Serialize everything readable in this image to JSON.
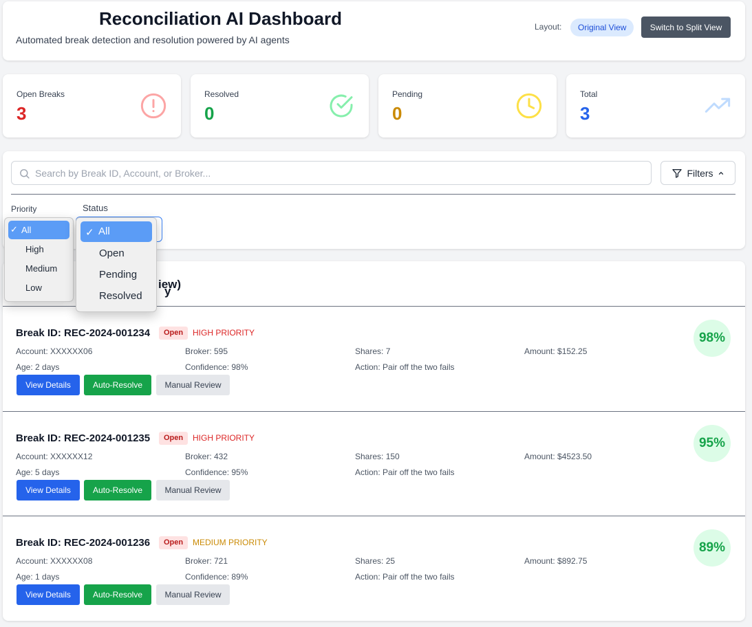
{
  "header": {
    "title": "Reconciliation AI Dashboard",
    "subtitle": "Automated break detection and resolution powered by AI agents",
    "layout_label": "Layout:",
    "layout_value": "Original View",
    "switch_button": "Switch to Split View"
  },
  "stats": [
    {
      "label": "Open Breaks",
      "value": "3",
      "color": "#dc2626",
      "icon": "alert-circle-icon"
    },
    {
      "label": "Resolved",
      "value": "0",
      "color": "#16a34a",
      "icon": "check-circle-icon"
    },
    {
      "label": "Pending",
      "value": "0",
      "color": "#ca8a04",
      "icon": "clock-icon"
    },
    {
      "label": "Total",
      "value": "3",
      "color": "#2563eb",
      "icon": "trending-up-icon"
    }
  ],
  "filters": {
    "search_placeholder": "Search by Break ID, Account, or Broker...",
    "filters_button": "Filters",
    "priority_label": "Priority",
    "status_label": "Status",
    "priority_options": [
      "All",
      "High",
      "Medium",
      "Low"
    ],
    "priority_selected": "All",
    "status_options": [
      "All",
      "Open",
      "Pending",
      "Resolved"
    ],
    "status_selected": "All"
  },
  "list": {
    "title_visible_fragment": "iew)",
    "title_glyph": "y"
  },
  "breaks": [
    {
      "id": "Break ID: REC-2024-001234",
      "status": "Open",
      "priority": "HIGH PRIORITY",
      "priority_color": "#dc2626",
      "account": "Account: XXXXXX06",
      "broker": "Broker: 595",
      "shares": "Shares: 7",
      "amount": "Amount: $152.25",
      "age": "Age: 2 days",
      "confidence": "Confidence: 98%",
      "action": "Action: Pair off the two fails",
      "score": "98%"
    },
    {
      "id": "Break ID: REC-2024-001235",
      "status": "Open",
      "priority": "HIGH PRIORITY",
      "priority_color": "#dc2626",
      "account": "Account: XXXXXX12",
      "broker": "Broker: 432",
      "shares": "Shares: 150",
      "amount": "Amount: $4523.50",
      "age": "Age: 5 days",
      "confidence": "Confidence: 95%",
      "action": "Action: Pair off the two fails",
      "score": "95%"
    },
    {
      "id": "Break ID: REC-2024-001236",
      "status": "Open",
      "priority": "MEDIUM PRIORITY",
      "priority_color": "#ca8a04",
      "account": "Account: XXXXXX08",
      "broker": "Broker: 721",
      "shares": "Shares: 25",
      "amount": "Amount: $892.75",
      "age": "Age: 1 days",
      "confidence": "Confidence: 89%",
      "action": "Action: Pair off the two fails",
      "score": "89%"
    }
  ],
  "actions": {
    "view_details": "View Details",
    "auto_resolve": "Auto-Resolve",
    "manual_review": "Manual Review"
  }
}
